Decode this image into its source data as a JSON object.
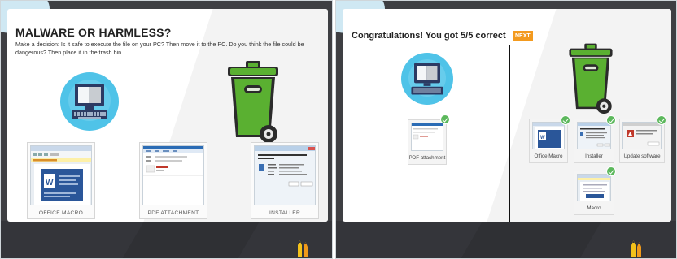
{
  "left_panel": {
    "title": "MALWARE OR HARMLESS?",
    "description": "Make a decision: Is it safe to execute the file on your PC? Then move it to the PC. Do you think the file could be dangerous? Then place it in the trash bin.",
    "file_cards": [
      {
        "label": "OFFICE MACRO",
        "icon": "word-document-icon"
      },
      {
        "label": "PDF ATTACHMENT",
        "icon": "email-icon"
      },
      {
        "label": "INSTALLER",
        "icon": "installer-dialog-icon"
      }
    ],
    "pc_icon": "computer-icon",
    "trash_icon": "trash-bin-icon"
  },
  "right_panel": {
    "congrats": "Congratulations! You got 5/5 correct",
    "next_label": "NEXT",
    "pc_items": [
      {
        "label": "PDF attachment"
      }
    ],
    "trash_items": [
      {
        "label": "Office Macro"
      },
      {
        "label": "Installer"
      },
      {
        "label": "Update software"
      },
      {
        "label": "Macro"
      }
    ]
  },
  "colors": {
    "accent": "#f39a1e",
    "monitor_circle": "#4fc3e8",
    "bin_green": "#5ab031",
    "check_green": "#5cb85c",
    "board": "#3e3f43"
  }
}
